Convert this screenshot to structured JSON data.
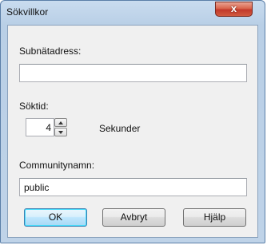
{
  "window": {
    "title": "Sökvillkor",
    "close_label": "x"
  },
  "subnet": {
    "label": "Subnätadress:",
    "value": ""
  },
  "search_time": {
    "label": "Söktid:",
    "value": "4",
    "unit": "Sekunder"
  },
  "community": {
    "label": "Communitynamn:",
    "value": "public"
  },
  "buttons": {
    "ok": "OK",
    "cancel": "Avbryt",
    "help": "Hjälp"
  }
}
